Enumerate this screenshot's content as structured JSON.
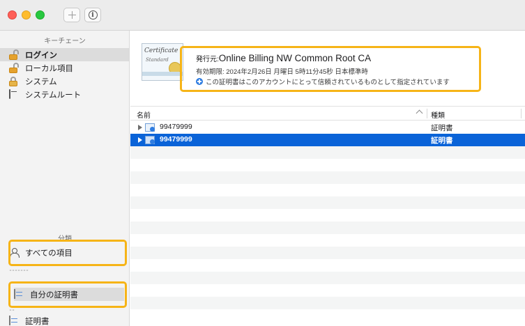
{
  "toolbar": {
    "add_label": "+",
    "info_label": "i"
  },
  "sidebar": {
    "keychains_header": "キーチェーン",
    "keychains": [
      {
        "label": "ログイン",
        "icon": "padlock-open-icon",
        "selected": true
      },
      {
        "label": "ローカル項目",
        "icon": "padlock-open-icon"
      },
      {
        "label": "システム",
        "icon": "padlock-closed-icon"
      },
      {
        "label": "システムルート",
        "icon": "folder-icon"
      }
    ],
    "category_header": "分類",
    "categories": [
      {
        "label": "すべての項目",
        "icon": "people-icon"
      },
      {
        "label": "自分の証明書",
        "icon": "certificate-icon",
        "selected": true
      },
      {
        "label": "証明書",
        "icon": "certificate-icon"
      }
    ]
  },
  "cert_info": {
    "issuer_label": "発行元:",
    "issuer_value": "Online Billing NW Common Root CA",
    "expiry": "有効期限: 2024年2月26日 月曜日 5時11分45秒 日本標準時",
    "trust_message": "この証明書はこのアカウントにとって信頼されているものとして指定されています"
  },
  "table": {
    "columns": [
      "名前",
      "種類"
    ],
    "rows": [
      {
        "name": "99479999",
        "kind": "証明書",
        "selected": false
      },
      {
        "name": "99479999",
        "kind": "証明書",
        "selected": true
      }
    ]
  },
  "colors": {
    "highlight": "#f6b417",
    "selection": "#0a63d8",
    "sidebar_bg": "#f3f3f3"
  }
}
